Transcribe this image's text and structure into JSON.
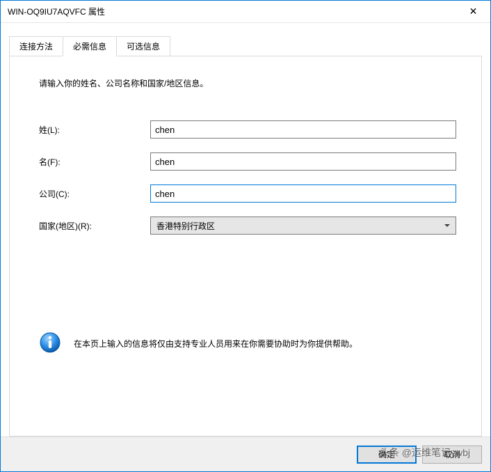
{
  "window": {
    "title": "WIN-OQ9IU7AQVFC 属性"
  },
  "tabs": {
    "connection": "连接方法",
    "required": "必需信息",
    "optional": "可选信息"
  },
  "instructions": "请输入你的姓名、公司名称和国家/地区信息。",
  "form": {
    "lastname_label": "姓(L):",
    "lastname_value": "chen",
    "firstname_label": "名(F):",
    "firstname_value": "chen",
    "company_label": "公司(C):",
    "company_value": "chen",
    "country_label": "国家(地区)(R):",
    "country_value": "香港特别行政区"
  },
  "info_text": "在本页上输入的信息将仅由支持专业人员用来在你需要协助时为你提供帮助。",
  "buttons": {
    "ok": "确定",
    "cancel": "取消"
  },
  "watermark": "头条 @运维笔记ywbj"
}
